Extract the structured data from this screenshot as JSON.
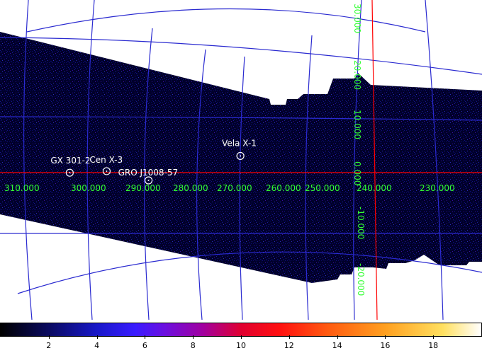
{
  "sources": [
    {
      "name": "Vela X-1",
      "x": 263.06,
      "y": 3.93
    },
    {
      "name": "Cen X-3",
      "x": 292.09,
      "y": 0.34
    },
    {
      "name": "GX 301-2",
      "x": 300.1,
      "y": -0.03
    },
    {
      "name": "GRO J1008-57",
      "x": 282.99,
      "y": -1.83
    }
  ],
  "axes": {
    "longitude_labels": [
      "310.000",
      "300.000",
      "290.000",
      "280.000",
      "270.000",
      "260.000",
      "250.000",
      "240.000",
      "230.000"
    ],
    "latitude_labels": [
      "30.000",
      "20.000",
      "10.000",
      "0.000",
      "-10.000",
      "-20.000"
    ]
  },
  "colorbar": {
    "tick_labels": [
      "2",
      "4",
      "6",
      "8",
      "10",
      "12",
      "14",
      "16",
      "18"
    ],
    "min": 0,
    "max": 20
  },
  "colors": {
    "background": "#00002a",
    "grid": "#3030d0",
    "axis": "#ff0000",
    "axis_labels": "#33ff33",
    "source_labels": "#ffffff"
  }
}
